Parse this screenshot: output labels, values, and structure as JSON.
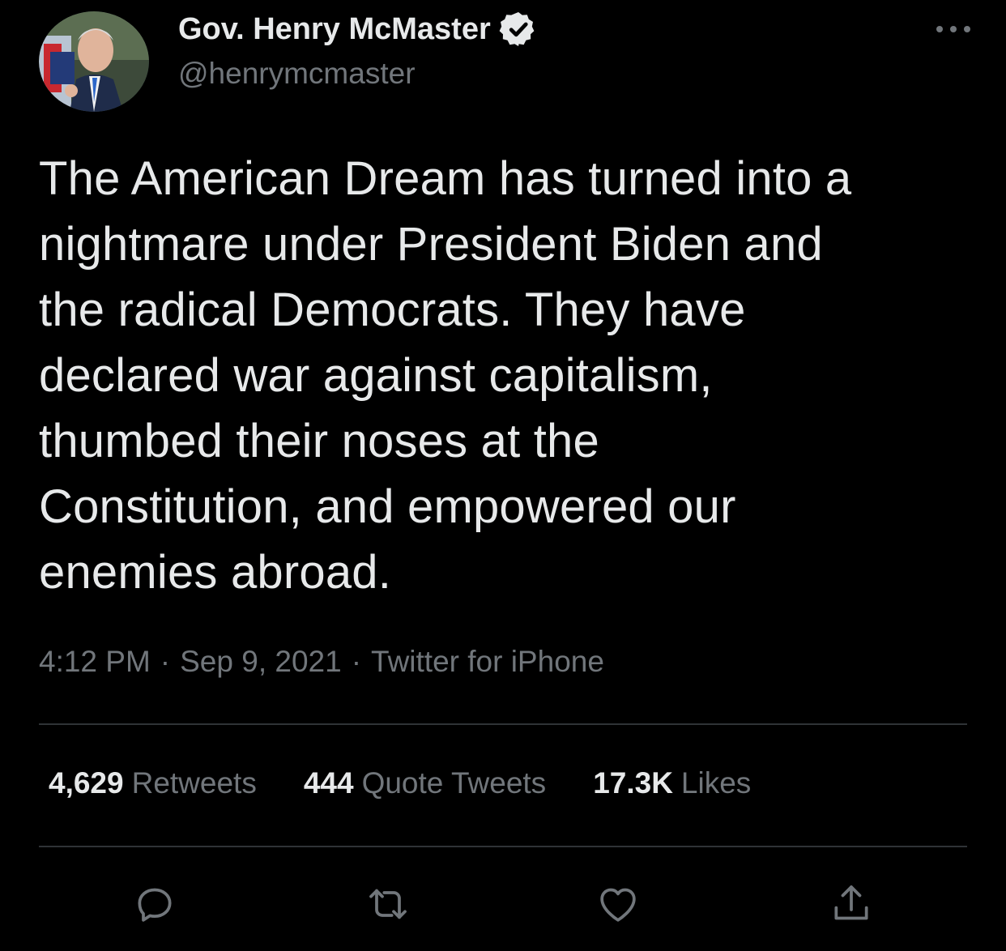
{
  "author": {
    "display_name": "Gov. Henry McMaster",
    "handle": "@henrymcmaster",
    "verified": true
  },
  "tweet": {
    "text_lines": [
      "The American Dream has turned into a",
      "nightmare under President Biden and",
      "the radical Democrats. They have",
      "declared war against capitalism,",
      "thumbed their noses at the",
      "Constitution, and empowered our",
      "enemies abroad."
    ],
    "time": "4:12 PM",
    "date": "Sep 9, 2021",
    "source": "Twitter for iPhone",
    "separator": "·"
  },
  "stats": {
    "retweets": {
      "count": "4,629",
      "label": "Retweets"
    },
    "quotes": {
      "count": "444",
      "label": "Quote Tweets"
    },
    "likes": {
      "count": "17.3K",
      "label": "Likes"
    }
  },
  "icons": {
    "more": "more-icon",
    "verified": "verified-badge-icon",
    "reply": "reply-icon",
    "retweet": "retweet-icon",
    "like": "heart-icon",
    "share": "share-icon"
  },
  "colors": {
    "background": "#000000",
    "text_primary": "#e7e9ea",
    "text_secondary": "#71767b",
    "divider": "#2f3336"
  }
}
